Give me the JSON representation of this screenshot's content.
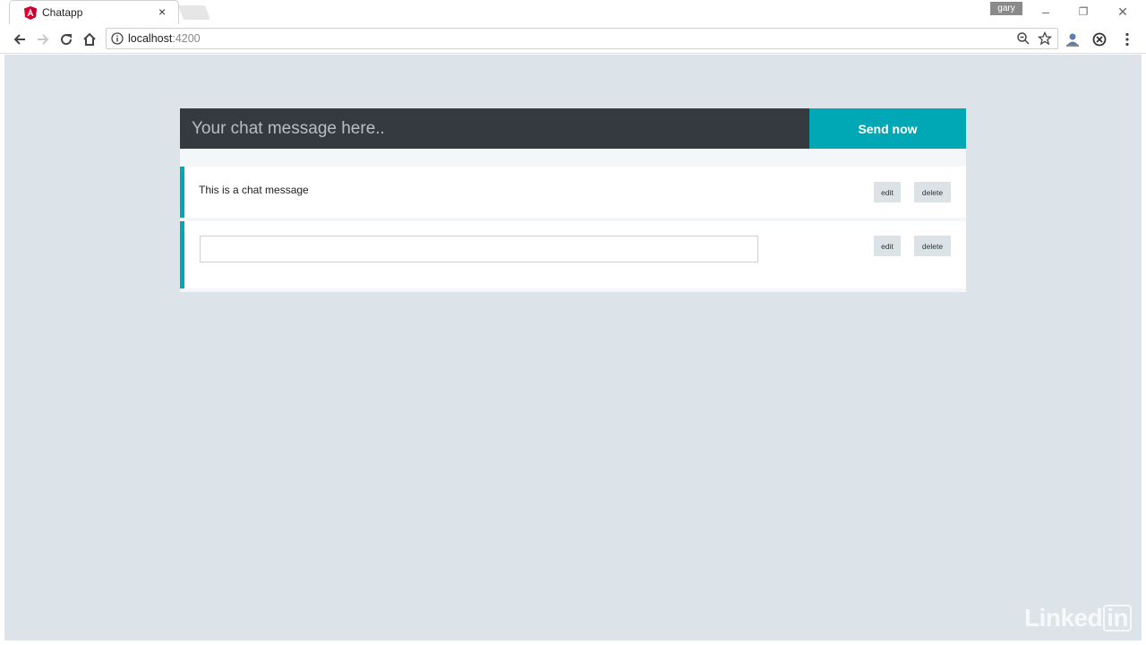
{
  "browser": {
    "tab": {
      "title": "Chatapp",
      "close_glyph": "×",
      "favicon": "angular-icon"
    },
    "profile_name": "gary",
    "window_controls": {
      "minimize": "–",
      "restore": "❐",
      "close": "✕"
    },
    "address_bar": {
      "host": "localhost",
      "port": ":4200"
    },
    "icons": [
      "back-icon",
      "forward-icon",
      "reload-icon",
      "home-icon",
      "info-icon",
      "zoom-icon",
      "bookmark-star-icon",
      "extension-icon",
      "sync-icon",
      "menu-icon"
    ]
  },
  "composer": {
    "placeholder": "Your chat message here..",
    "send_label": "Send now"
  },
  "messages": [
    {
      "text": "This is a chat message",
      "edit_label": "edit",
      "delete_label": "delete",
      "editing": false
    },
    {
      "text": "",
      "edit_label": "edit",
      "delete_label": "delete",
      "editing": true
    }
  ],
  "watermark": {
    "text": "Linked",
    "box_text": "in"
  },
  "colors": {
    "accent": "#00a7b5",
    "composer_bg": "#343a40",
    "page_bg": "#dce4e9"
  }
}
